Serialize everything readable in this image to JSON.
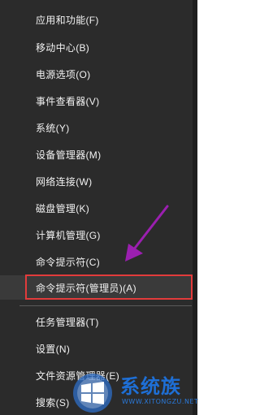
{
  "menu": {
    "items": [
      {
        "label": "应用和功能(F)"
      },
      {
        "label": "移动中心(B)"
      },
      {
        "label": "电源选项(O)"
      },
      {
        "label": "事件查看器(V)"
      },
      {
        "label": "系统(Y)"
      },
      {
        "label": "设备管理器(M)"
      },
      {
        "label": "网络连接(W)"
      },
      {
        "label": "磁盘管理(K)"
      },
      {
        "label": "计算机管理(G)"
      },
      {
        "label": "命令提示符(C)"
      },
      {
        "label": "命令提示符(管理员)(A)"
      },
      {
        "label": "任务管理器(T)"
      },
      {
        "label": "设置(N)"
      },
      {
        "label": "文件资源管理器(E)"
      },
      {
        "label": "搜索(S)"
      }
    ]
  },
  "annotation": {
    "highlight_color": "#e23b3b",
    "arrow_color": "#9b1fb0"
  },
  "watermark": {
    "brand": "系统族",
    "url": "WWW.XITONGZU.NET",
    "logo": "windows-logo-icon"
  }
}
